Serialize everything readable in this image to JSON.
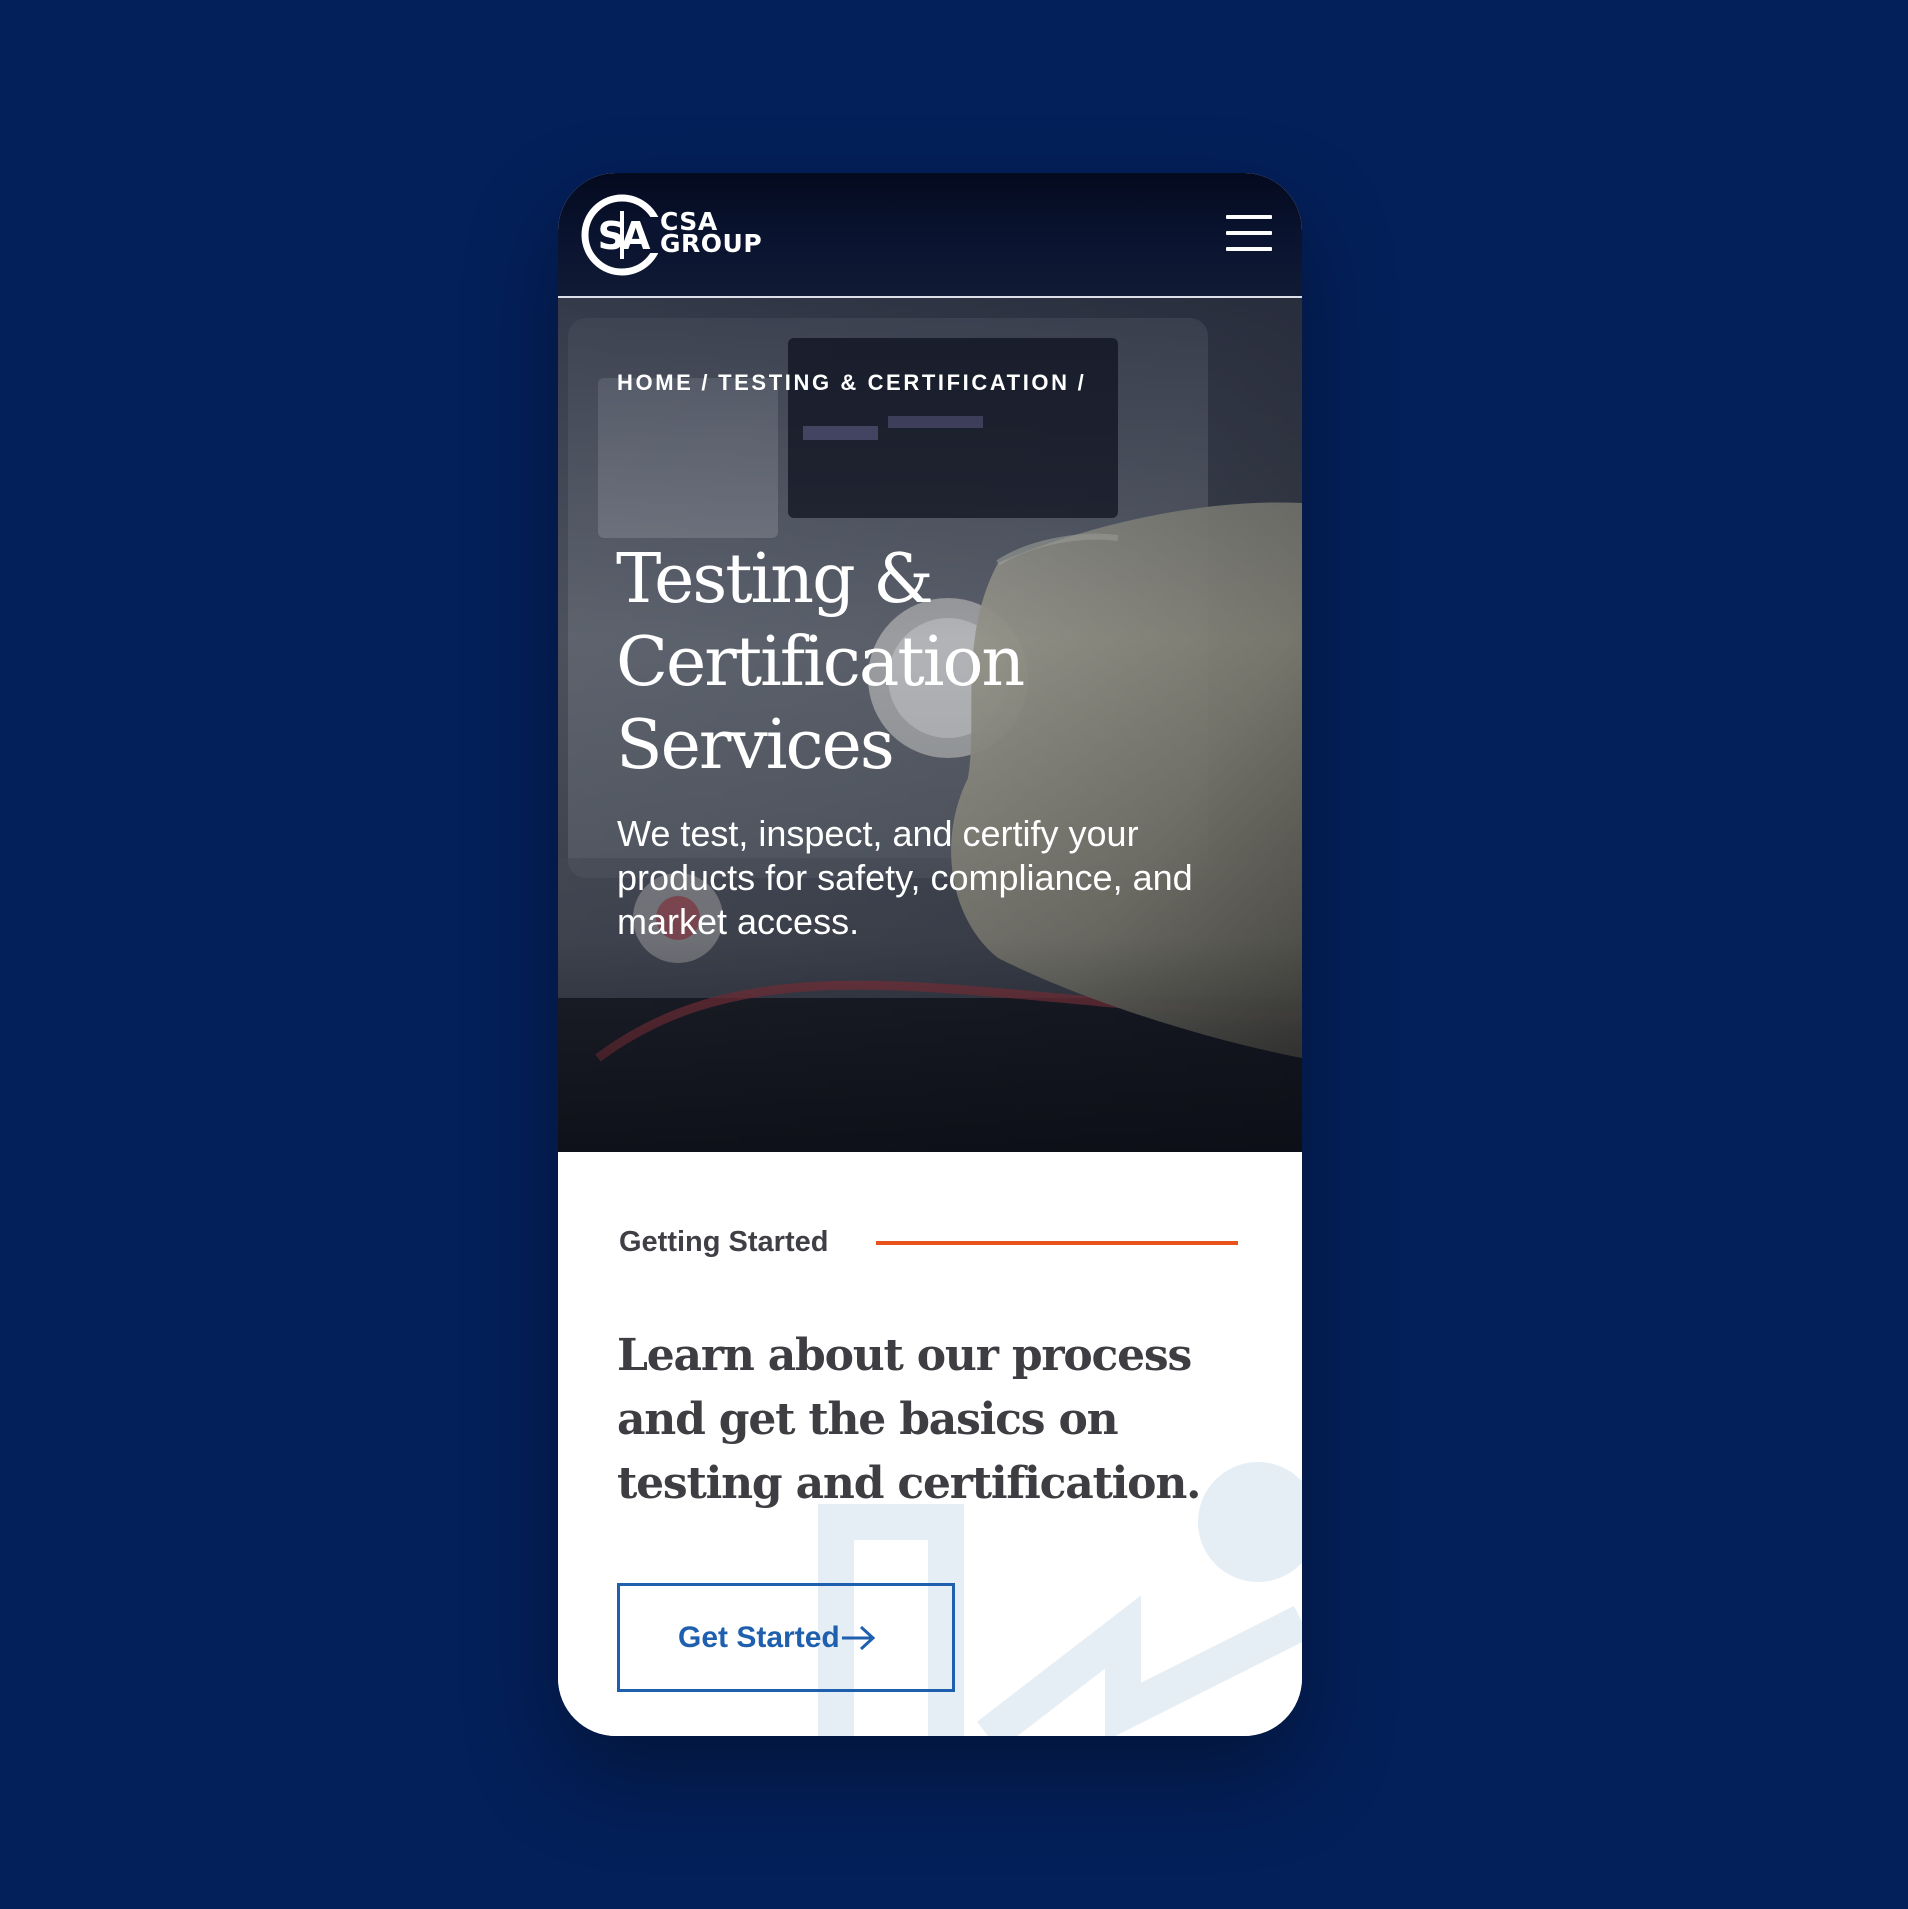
{
  "brand": {
    "name_line1": "CSA",
    "name_line2": "GROUP",
    "logo_icon": "csa-logo-icon",
    "background_color": "#04205a"
  },
  "header": {
    "menu_icon": "hamburger-menu-icon"
  },
  "breadcrumb": {
    "items": [
      "HOME",
      "TESTING & CERTIFICATION"
    ],
    "separator": "/"
  },
  "hero": {
    "title_lines": [
      "Testing &",
      "Certification",
      "Services"
    ],
    "subtitle": "We test, inspect, and certify your products for safety, compliance, and market access."
  },
  "getting_started": {
    "eyebrow": "Getting Started",
    "accent_color": "#e8531b",
    "heading_lines": [
      "Learn about our process",
      "and get the basics on",
      "testing and certification."
    ],
    "cta_label": "Get Started",
    "cta_icon": "arrow-right-icon",
    "cta_color": "#1e5fae"
  }
}
